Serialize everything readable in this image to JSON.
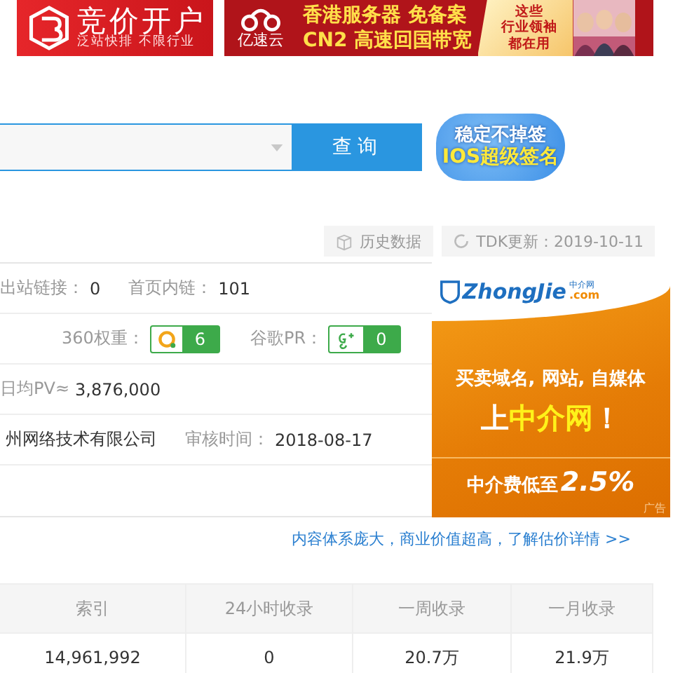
{
  "top_ads": [
    {
      "kind": "promo",
      "title": "竞价开户",
      "subtitle": "泛站快排 不限行业"
    },
    {
      "kind": "hosting",
      "brand": "亿速云",
      "lines": [
        "香港服务器 免备案",
        "CN2 高速回国带宽"
      ],
      "side_lines": [
        "这些",
        "行业领袖",
        "都在用"
      ]
    }
  ],
  "search": {
    "button": "查询"
  },
  "badge_ad": {
    "lines": [
      "稳定不掉签",
      "IOS超级签名"
    ]
  },
  "tools": [
    {
      "kind": "history",
      "label": "历史数据"
    },
    {
      "kind": "refresh",
      "label": "TDK更新：2019-10-11"
    }
  ],
  "info_rows": [
    {
      "items": [
        {
          "kind": "text",
          "label": "出站链接：",
          "value": "0"
        },
        {
          "kind": "text",
          "label": "首页内链：",
          "value": "101"
        }
      ]
    },
    {
      "items": [
        {
          "kind": "so360",
          "label": "360权重：",
          "value": "6"
        },
        {
          "kind": "google",
          "label": "谷歌PR：",
          "value": "0"
        }
      ]
    },
    {
      "items": [
        {
          "kind": "text",
          "label": "日均PV≈",
          "value": "3,876,000"
        }
      ]
    },
    {
      "items": [
        {
          "kind": "text",
          "value": "州网络技术有限公司"
        },
        {
          "kind": "text",
          "label": "审核时间：",
          "value": "2018-08-17"
        }
      ]
    }
  ],
  "side_ad": {
    "logo": "ZhongJie",
    "logo_cn": "中介网",
    "logo_domain": ".com",
    "line": "买卖域名, 网站, 自媒体",
    "headline": [
      {
        "text": "上",
        "highlight": false
      },
      {
        "text": "中介网",
        "highlight": true
      },
      {
        "text": "！",
        "highlight": false
      }
    ],
    "fee": "中介费低至",
    "fee_value": "2.5%",
    "tag": "广告"
  },
  "link": "内容体系庞大，商业价值超高，了解估价详情 >>",
  "table": {
    "columns": [
      "索引",
      "24小时收录",
      "一周收录",
      "一月收录"
    ],
    "rows": [
      [
        "14,961,992",
        "0",
        "20.7万",
        "21.9万"
      ]
    ]
  }
}
